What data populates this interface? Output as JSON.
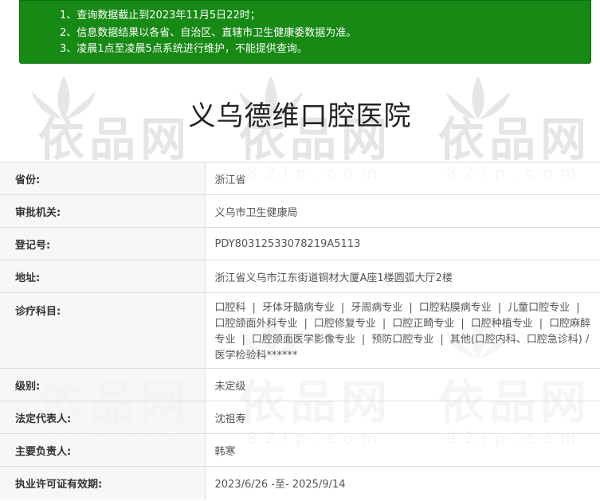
{
  "notice": {
    "lines": [
      "1、查询数据截止到2023年11月5日22时；",
      "2、信息数据结果以各省、自治区、直辖市卫生健康委数据为准。",
      "3、凌晨1点至凌晨5点系统进行维护，不能提供查询。"
    ]
  },
  "watermark": {
    "text": "依品网",
    "sub": "82ip.com"
  },
  "title": "义乌德维口腔医院",
  "fields": {
    "province": {
      "label": "省份:",
      "value": "浙江省"
    },
    "authority": {
      "label": "审批机关:",
      "value": "义乌市卫生健康局"
    },
    "reg_no": {
      "label": "登记号:",
      "value": "PDY80312533078219A5113"
    },
    "address": {
      "label": "地址:",
      "value": "浙江省义乌市江东街道铜材大厦A座1楼圆弧大厅2楼"
    },
    "departments": {
      "label": "诊疗科目:",
      "items": [
        "口腔科",
        "牙体牙髓病专业",
        "牙周病专业",
        "口腔粘膜病专业",
        "儿童口腔专业",
        "口腔颌面外科专业",
        "口腔修复专业",
        "口腔正畸专业",
        "口腔种植专业",
        "口腔麻醉专业",
        "口腔颌面医学影像专业",
        "预防口腔专业",
        "其他(口腔内科、口腔急诊科) /医学检验科******"
      ]
    },
    "level": {
      "label": "级别:",
      "value": "未定级"
    },
    "legal_rep": {
      "label": "法定代表人:",
      "value": "沈祖寿"
    },
    "principal": {
      "label": "主要负责人:",
      "value": "韩寒"
    },
    "license_validity": {
      "label": "执业许可证有效期:",
      "value": "2023/6/26 -至- 2025/9/14"
    }
  },
  "colors": {
    "notice_bg": "#168a14",
    "label_bg": "#f6f6f6",
    "border": "#dddddd"
  }
}
